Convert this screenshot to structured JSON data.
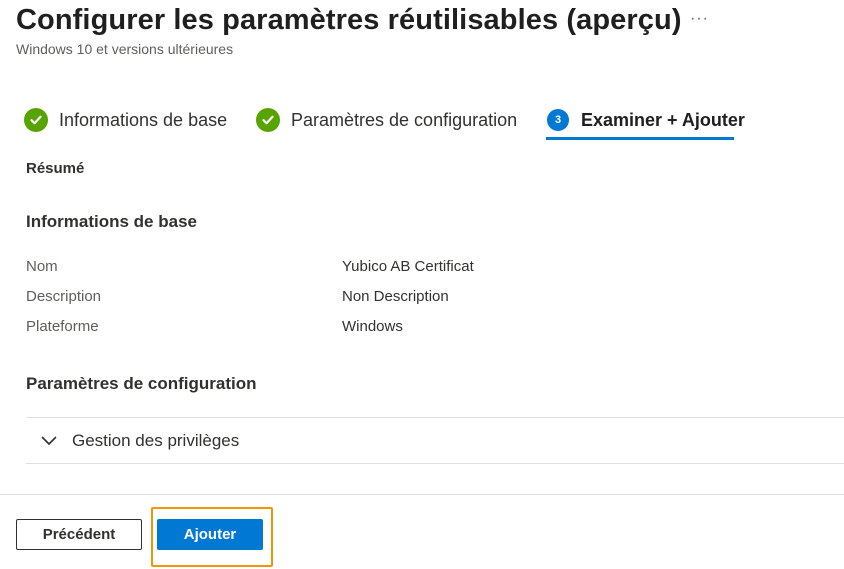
{
  "header": {
    "title": "Configurer les paramètres réutilisables (aperçu)",
    "more_label": "···",
    "subtitle": "Windows 10 et versions ultérieures"
  },
  "wizard": {
    "steps": [
      {
        "label": "Informations de base",
        "status": "complete",
        "icon": "checkmark-icon"
      },
      {
        "label": "Paramètres de configuration",
        "status": "complete",
        "icon": "checkmark-icon"
      },
      {
        "label": "Examiner + Ajouter",
        "status": "active",
        "number": "3"
      }
    ]
  },
  "summary_label": "Résumé",
  "basics": {
    "title": "Informations de base",
    "rows": [
      {
        "key": "Nom",
        "value": "Yubico AB Certificat"
      },
      {
        "key": "Description",
        "value": "Non Description"
      },
      {
        "key": "Plateforme",
        "value": "Windows"
      }
    ]
  },
  "config": {
    "title": "Paramètres de configuration",
    "accordion_label": "Gestion des privilèges",
    "accordion_icon": "chevron-down-icon"
  },
  "footer": {
    "prev_label": "Précédent",
    "add_label": "Ajouter"
  },
  "colors": {
    "accent": "#0078d4",
    "success": "#57a300",
    "highlight": "#f0940a"
  }
}
